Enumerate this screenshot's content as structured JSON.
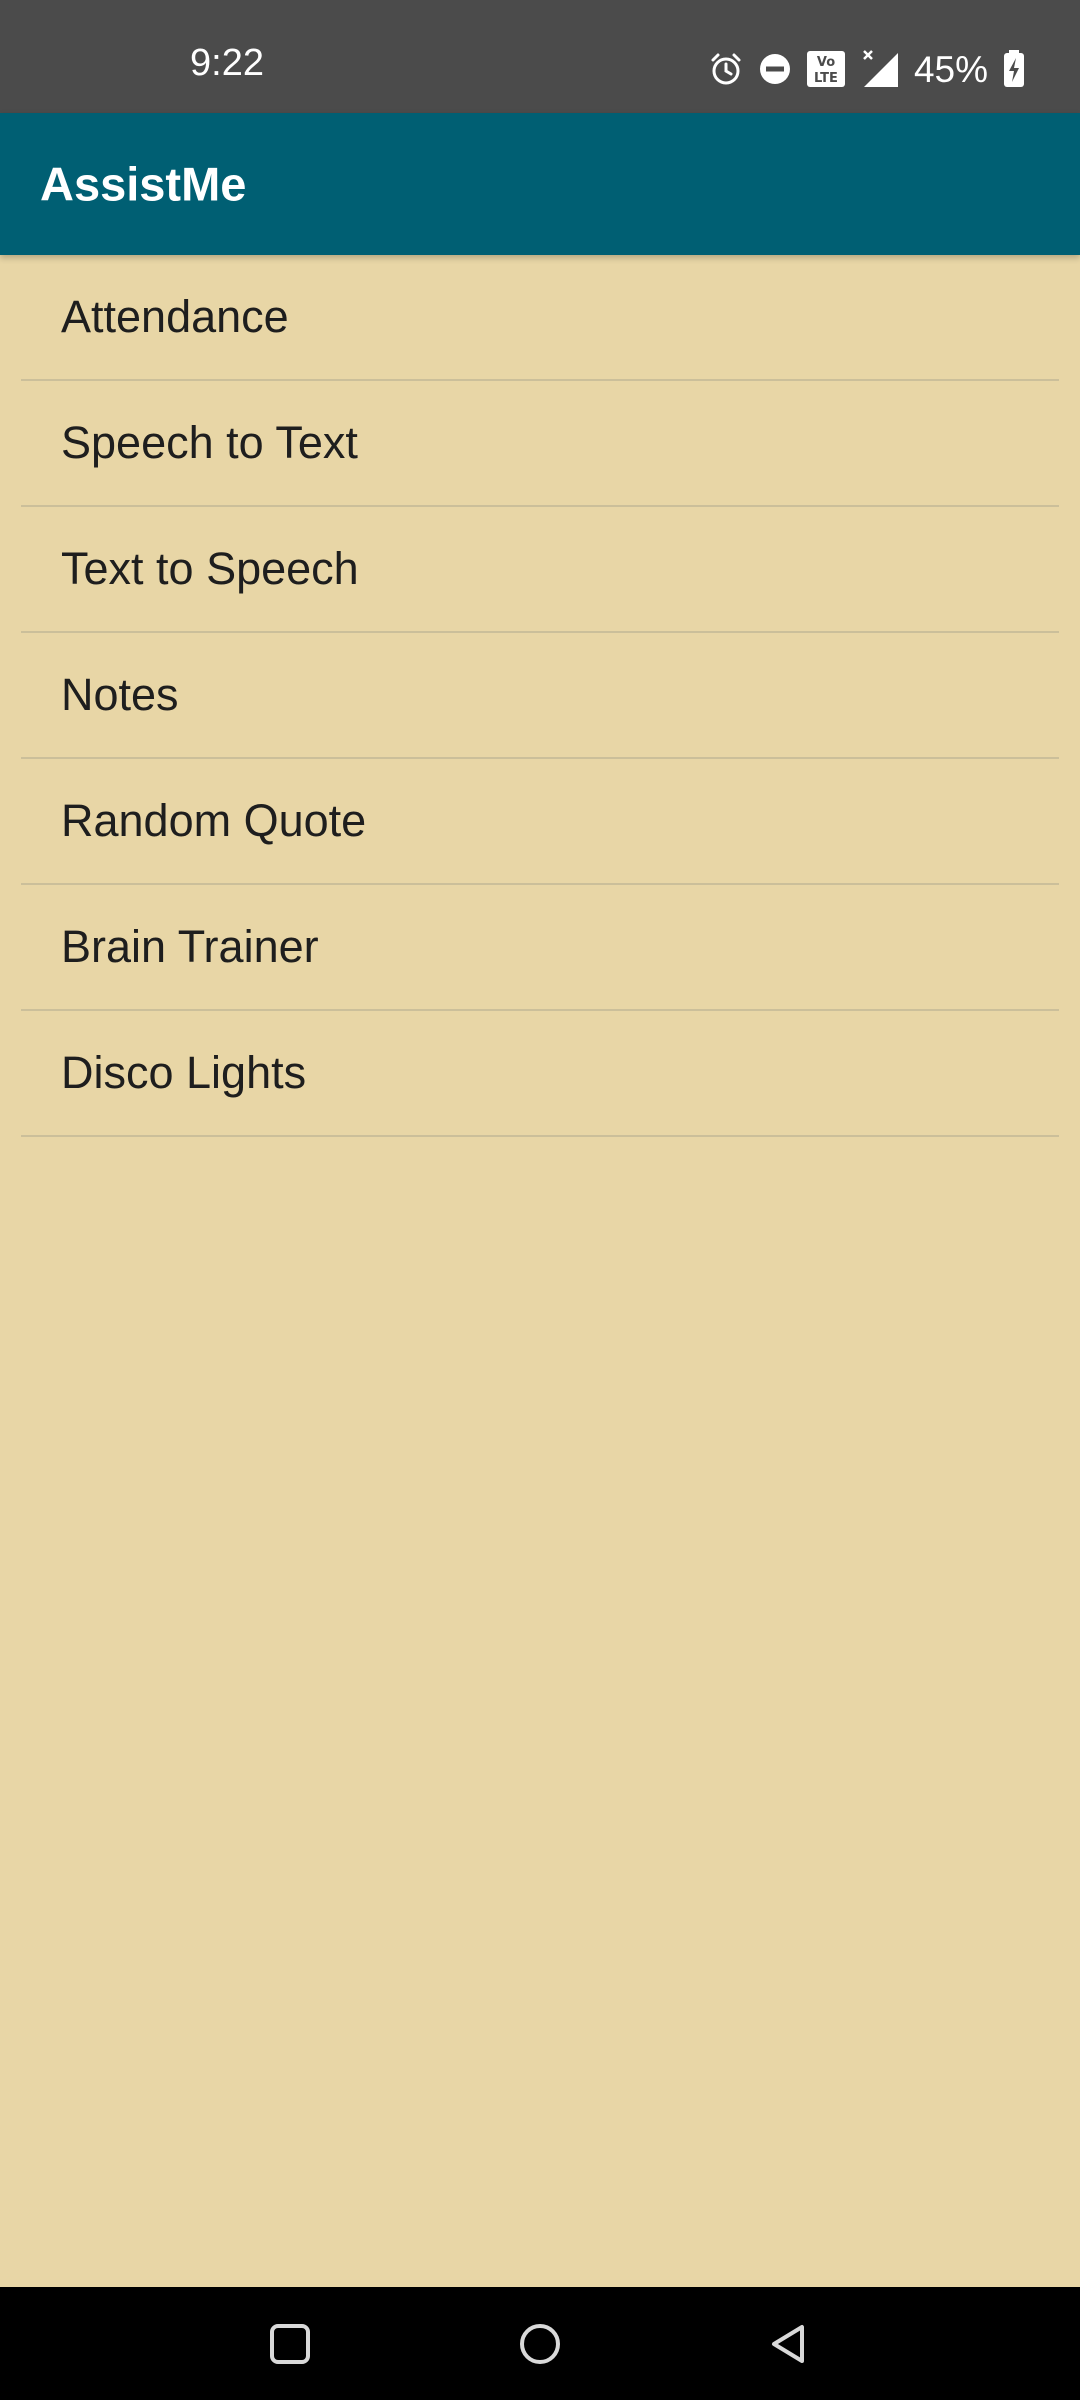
{
  "status_bar": {
    "time": "9:22",
    "battery_percent": "45%",
    "icons": [
      "alarm-icon",
      "do-not-disturb-icon",
      "volte-icon",
      "signal-icon",
      "battery-charging-icon"
    ]
  },
  "app_bar": {
    "title": "AssistMe",
    "background_color": "#005f73"
  },
  "menu": {
    "items": [
      {
        "label": "Attendance"
      },
      {
        "label": "Speech to Text"
      },
      {
        "label": "Text to Speech"
      },
      {
        "label": "Notes"
      },
      {
        "label": "Random Quote"
      },
      {
        "label": "Brain Trainer"
      },
      {
        "label": "Disco Lights"
      }
    ]
  },
  "nav_bar": {
    "buttons": [
      "recents-icon",
      "home-icon",
      "back-icon"
    ]
  },
  "colors": {
    "page_background": "#e8d6a6",
    "status_bar": "#4b4b4b",
    "divider": "#cbbf9a"
  }
}
